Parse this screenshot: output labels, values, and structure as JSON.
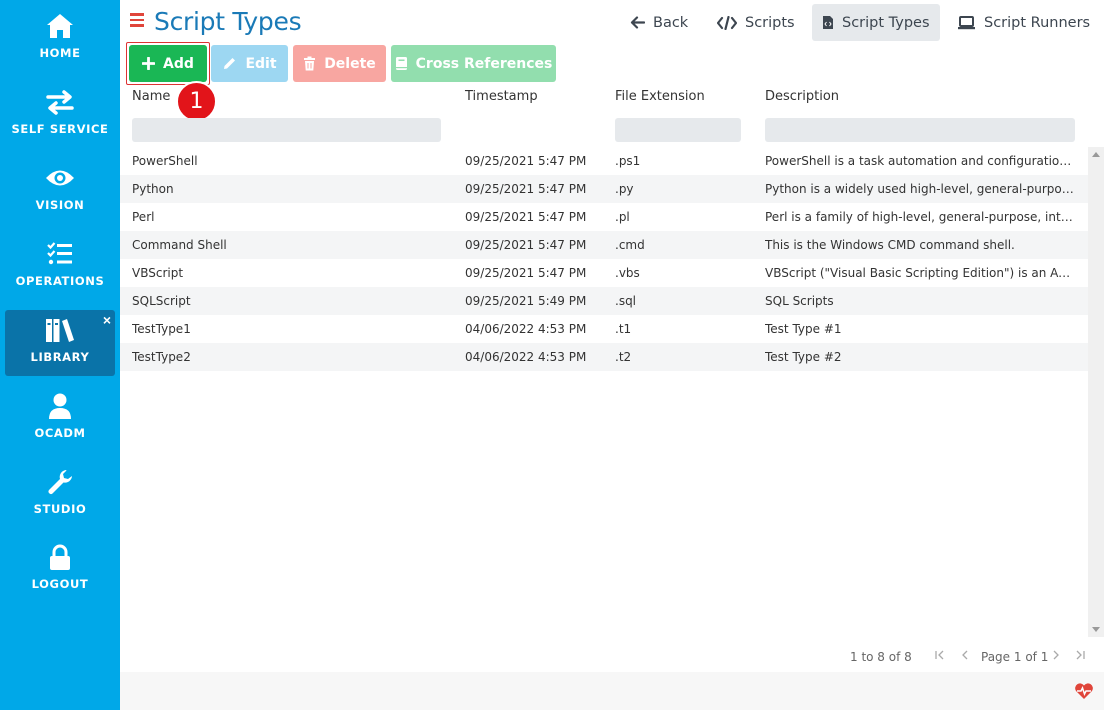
{
  "sidebar": {
    "items": [
      {
        "label": "HOME",
        "icon": "home-icon"
      },
      {
        "label": "SELF SERVICE",
        "icon": "arrows-exchange-icon"
      },
      {
        "label": "VISION",
        "icon": "eye-icon"
      },
      {
        "label": "OPERATIONS",
        "icon": "checklist-icon"
      },
      {
        "label": "LIBRARY",
        "icon": "books-icon",
        "active": true
      },
      {
        "label": "OCADM",
        "icon": "user-icon"
      },
      {
        "label": "STUDIO",
        "icon": "wrench-icon"
      },
      {
        "label": "LOGOUT",
        "icon": "lock-icon"
      }
    ],
    "close_label": "×"
  },
  "header": {
    "title": "Script Types",
    "nav": [
      {
        "label": "Back",
        "icon": "arrow-left-icon"
      },
      {
        "label": "Scripts",
        "icon": "code-icon"
      },
      {
        "label": "Script Types",
        "icon": "file-code-icon",
        "active": true
      },
      {
        "label": "Script Runners",
        "icon": "laptop-icon"
      }
    ]
  },
  "toolbar": {
    "add_label": "Add",
    "edit_label": "Edit",
    "delete_label": "Delete",
    "xref_label": "Cross References"
  },
  "step_badge": "1",
  "grid": {
    "columns": [
      "Name",
      "Timestamp",
      "File Extension",
      "Description"
    ],
    "rows": [
      [
        "PowerShell",
        "09/25/2021 5:47 PM",
        ".ps1",
        "PowerShell is a task automation and configuration man..."
      ],
      [
        "Python",
        "09/25/2021 5:47 PM",
        ".py",
        "Python is a widely used high-level, general-purpose, inte..."
      ],
      [
        "Perl",
        "09/25/2021 5:47 PM",
        ".pl",
        "Perl is a family of high-level, general-purpose, interprete..."
      ],
      [
        "Command Shell",
        "09/25/2021 5:47 PM",
        ".cmd",
        "This is the Windows CMD command shell."
      ],
      [
        "VBScript",
        "09/25/2021 5:47 PM",
        ".vbs",
        "VBScript (\"Visual Basic Scripting Edition\") is an Active Scr..."
      ],
      [
        "SQLScript",
        "09/25/2021 5:49 PM",
        ".sql",
        "SQL Scripts"
      ],
      [
        "TestType1",
        "04/06/2022 4:53 PM",
        ".t1",
        "Test Type #1"
      ],
      [
        "TestType2",
        "04/06/2022 4:53 PM",
        ".t2",
        "Test Type #2"
      ]
    ]
  },
  "pager": {
    "count": "1 to 8 of 8",
    "page": "Page 1 of 1",
    "first": "|<",
    "prev": "<",
    "next": ">",
    "last": ">|"
  },
  "colors": {
    "sidebar": "#00a8e8",
    "sidebar_active": "#0a73a8",
    "title": "#1a7ab7",
    "add": "#1ab755",
    "edit": "#9dd7f2",
    "delete": "#f8a6a1",
    "xref": "#92deae"
  }
}
